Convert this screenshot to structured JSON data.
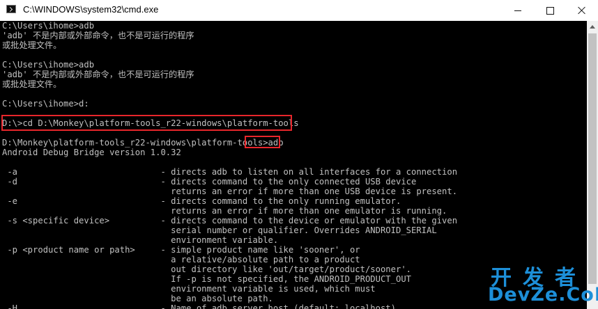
{
  "window": {
    "title": "C:\\WINDOWS\\system32\\cmd.exe",
    "icon": "cmd-icon"
  },
  "console": {
    "lines": [
      "C:\\Users\\ihome>adb",
      "'adb' 不是内部或外部命令，也不是可运行的程序",
      "或批处理文件。",
      "",
      "C:\\Users\\ihome>adb",
      "'adb' 不是内部或外部命令，也不是可运行的程序",
      "或批处理文件。",
      "",
      "C:\\Users\\ihome>d:",
      "",
      "D:\\>cd D:\\Monkey\\platform-tools_r22-windows\\platform-tools",
      "",
      "D:\\Monkey\\platform-tools_r22-windows\\platform-tools>adb",
      "Android Debug Bridge version 1.0.32",
      "",
      " -a                            - directs adb to listen on all interfaces for a connection",
      " -d                            - directs command to the only connected USB device",
      "                                 returns an error if more than one USB device is present.",
      " -e                            - directs command to the only running emulator.",
      "                                 returns an error if more than one emulator is running.",
      " -s <specific device>          - directs command to the device or emulator with the given",
      "                                 serial number or qualifier. Overrides ANDROID_SERIAL",
      "                                 environment variable.",
      " -p <product name or path>     - simple product name like 'sooner', or",
      "                                 a relative/absolute path to a product",
      "                                 out directory like 'out/target/product/sooner'.",
      "                                 If -p is not specified, the ANDROID_PRODUCT_OUT",
      "                                 environment variable is used, which must",
      "                                 be an absolute path.",
      " -H                            - Name of adb server host (default: localhost)"
    ],
    "text_color": "#c0c0c0",
    "background": "#000000",
    "highlight_color": "#e8262b"
  },
  "watermark": {
    "cn": "开发者",
    "en": "DevZe.CoM",
    "color": "#1d8fd8"
  }
}
